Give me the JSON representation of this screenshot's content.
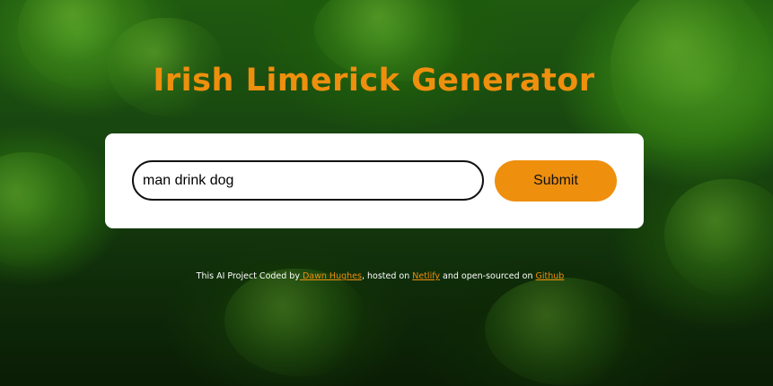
{
  "page": {
    "title": "Irish Limerick Generator"
  },
  "form": {
    "input_value": "man drink dog",
    "submit_label": "Submit"
  },
  "footer": {
    "text_before": "This AI Project Coded by",
    "author_link": " Dawn Hughes",
    "text_middle": ", hosted on ",
    "host_link": "Netlify",
    "text_after": " and open-sourced on ",
    "source_link": "Github"
  },
  "colors": {
    "accent": "#ee8f0e",
    "card": "#ffffff",
    "background": "#1f5a10"
  },
  "icons": {
    "background": "shamrock-clover-image"
  }
}
